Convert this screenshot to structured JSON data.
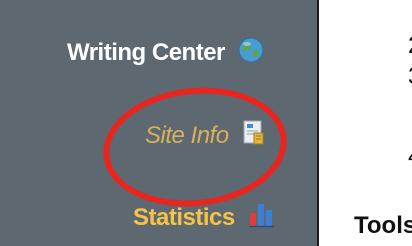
{
  "sidebar": {
    "items": [
      {
        "label": "Writing Center",
        "icon": "globe-icon"
      },
      {
        "label": "Site Info",
        "icon": "document-icon"
      },
      {
        "label": "Statistics",
        "icon": "bar-chart-icon"
      }
    ]
  },
  "main": {
    "list_markers": [
      "2",
      "3",
      "4"
    ],
    "heading": "Tools"
  },
  "colors": {
    "sidebar_bg": "#5e6871",
    "highlight": "#e8251f",
    "site_info_text": "#d9b15a",
    "statistics_text": "#f6c346"
  }
}
